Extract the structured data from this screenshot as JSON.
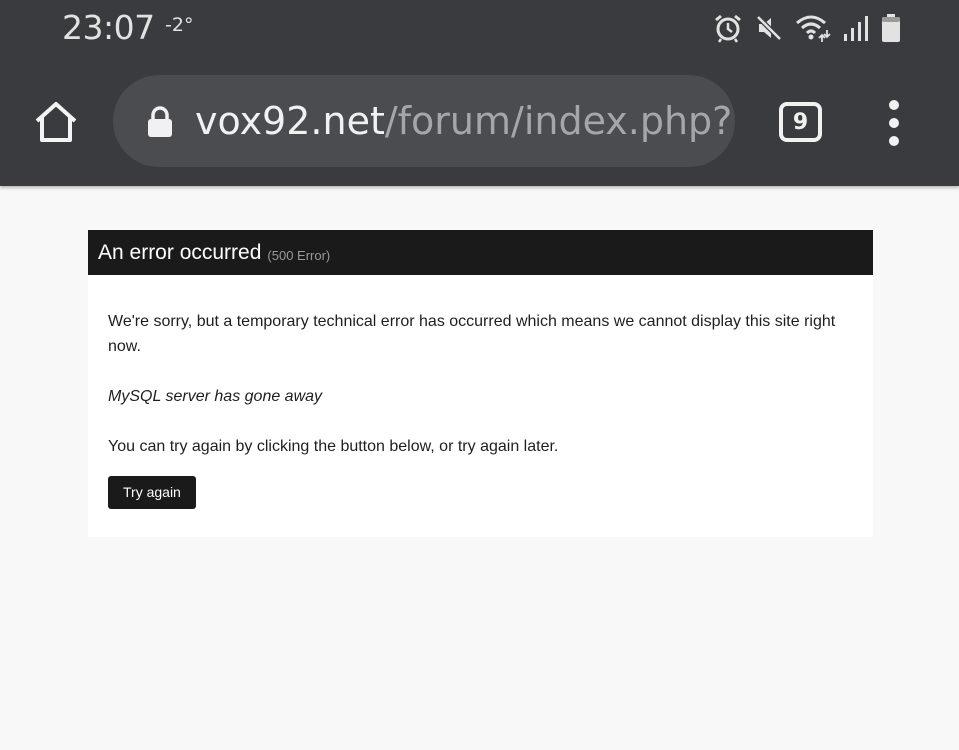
{
  "status_bar": {
    "time": "23:07",
    "temperature": "-2°",
    "icons": [
      "alarm-icon",
      "mute-icon",
      "wifi-icon",
      "signal-icon",
      "battery-icon"
    ]
  },
  "browser": {
    "url_domain": "vox92.net",
    "url_path": "/forum/index.php?/",
    "tab_count": "9"
  },
  "error": {
    "title": "An error occurred",
    "code": "(500 Error)",
    "message": "We're sorry, but a temporary technical error has occurred which means we cannot display this site right now.",
    "detail": "MySQL server has gone away",
    "hint": "You can try again by clicking the button below, or try again later.",
    "button_label": "Try again"
  },
  "colors": {
    "chrome_background": "#3a3b3e",
    "omnibox_background": "#4b4c50",
    "header_background": "#1a1a1a",
    "page_background": "#f8f8f8"
  }
}
